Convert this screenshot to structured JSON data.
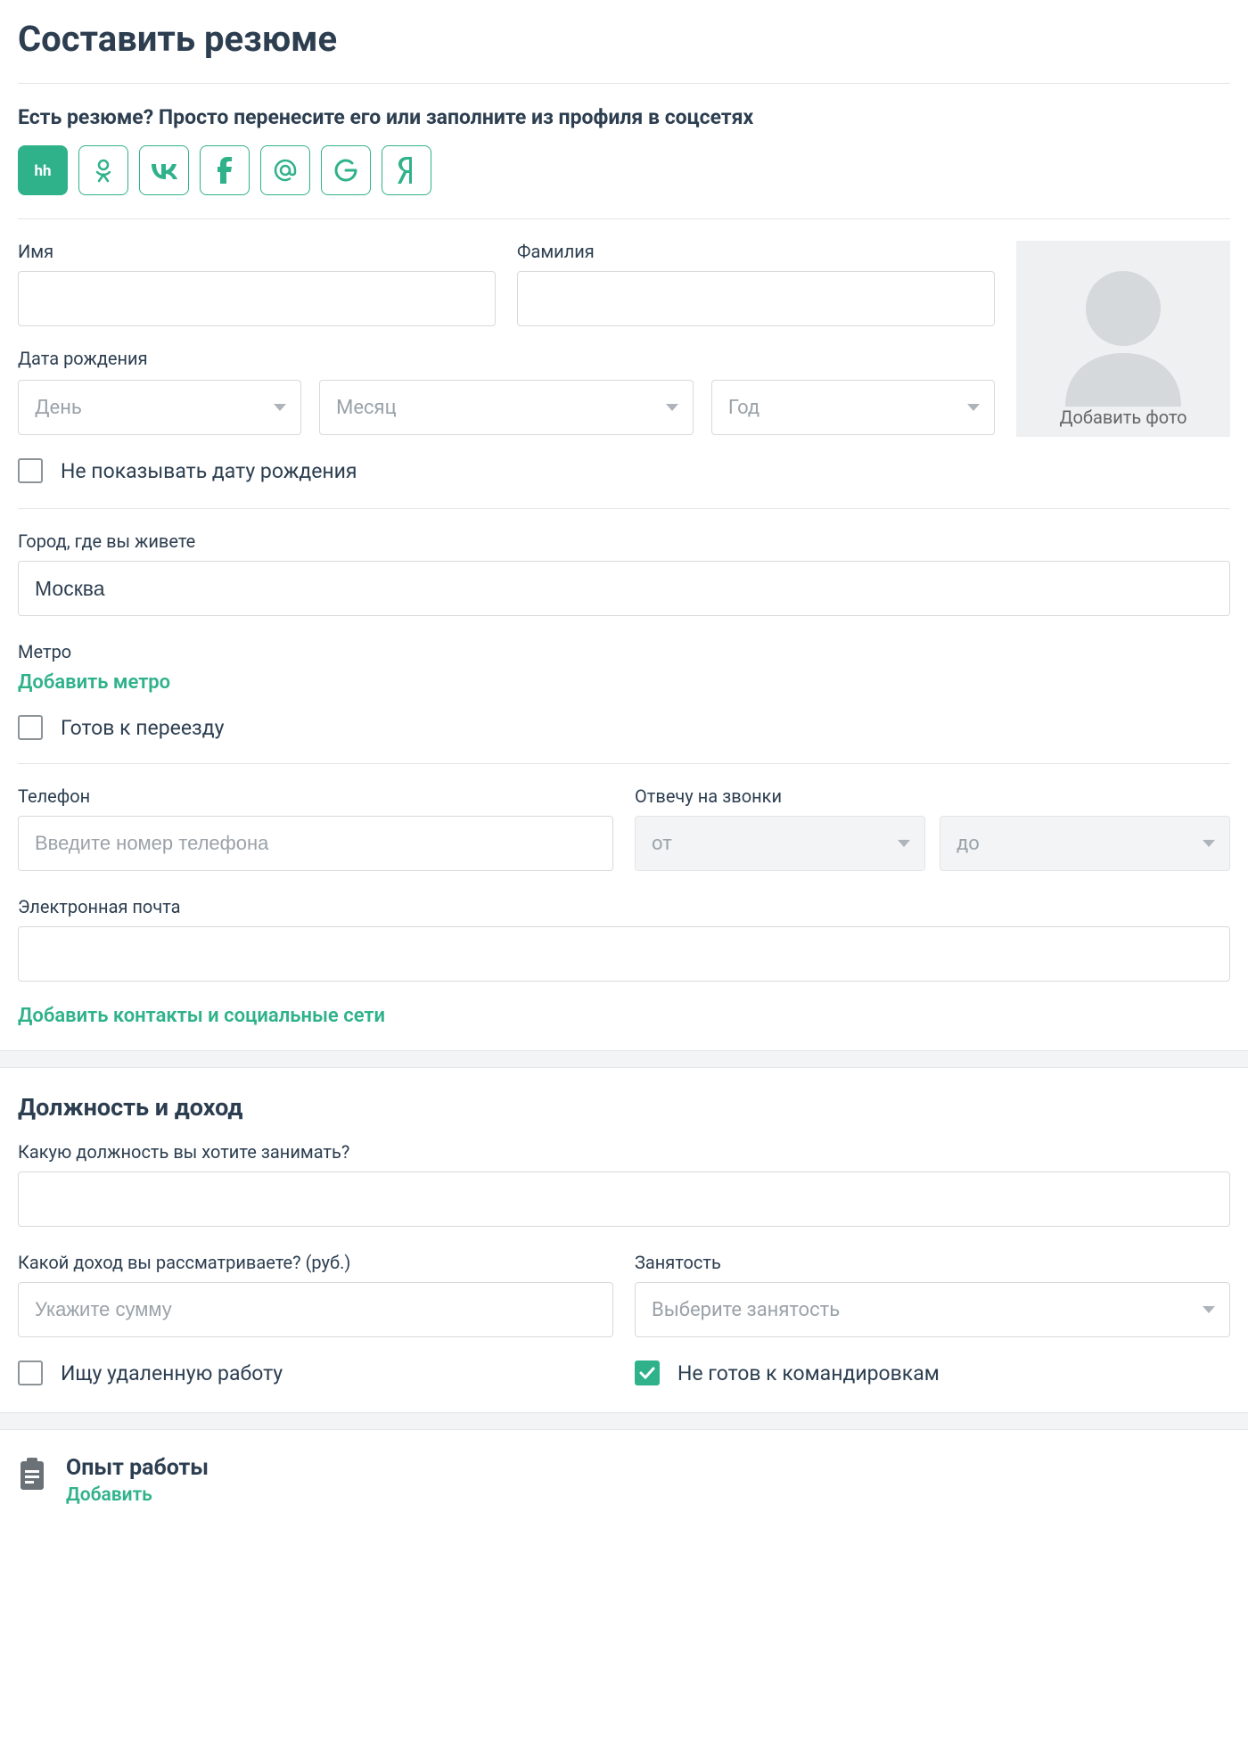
{
  "page": {
    "title": "Составить резюме",
    "import_label": "Есть резюме? Просто перенесите его или заполните из профиля в соцсетях"
  },
  "social": {
    "buttons": [
      "hh",
      "ok",
      "vk",
      "facebook",
      "mailru",
      "google",
      "yandex"
    ]
  },
  "personal": {
    "first_name_label": "Имя",
    "last_name_label": "Фамилия",
    "first_name": "",
    "last_name": "",
    "dob_label": "Дата рождения",
    "day_placeholder": "День",
    "month_placeholder": "Месяц",
    "year_placeholder": "Год",
    "photo_label": "Добавить фото",
    "hide_dob_label": "Не показывать дату рождения",
    "hide_dob_checked": false
  },
  "location": {
    "city_label": "Город, где вы живете",
    "city_value": "Москва",
    "metro_label": "Метро",
    "add_metro_link": "Добавить метро",
    "relocate_label": "Готов к переезду",
    "relocate_checked": false
  },
  "contacts": {
    "phone_label": "Телефон",
    "phone_placeholder": "Введите номер телефона",
    "phone_value": "",
    "calls_label": "Отвечу на звонки",
    "from_placeholder": "от",
    "to_placeholder": "до",
    "email_label": "Электронная почта",
    "email_value": "",
    "add_contacts_link": "Добавить контакты и социальные сети"
  },
  "position": {
    "section_title": "Должность и доход",
    "position_label": "Какую должность вы хотите занимать?",
    "position_value": "",
    "salary_label": "Какой доход вы рассматриваете? (руб.)",
    "salary_placeholder": "Укажите сумму",
    "salary_value": "",
    "employment_label": "Занятость",
    "employment_placeholder": "Выберите занятость",
    "remote_label": "Ищу удаленную работу",
    "remote_checked": false,
    "no_trips_label": "Не готов к командировкам",
    "no_trips_checked": true
  },
  "experience": {
    "title": "Опыт работы",
    "add_link": "Добавить"
  },
  "colors": {
    "accent": "#2fb28a"
  }
}
